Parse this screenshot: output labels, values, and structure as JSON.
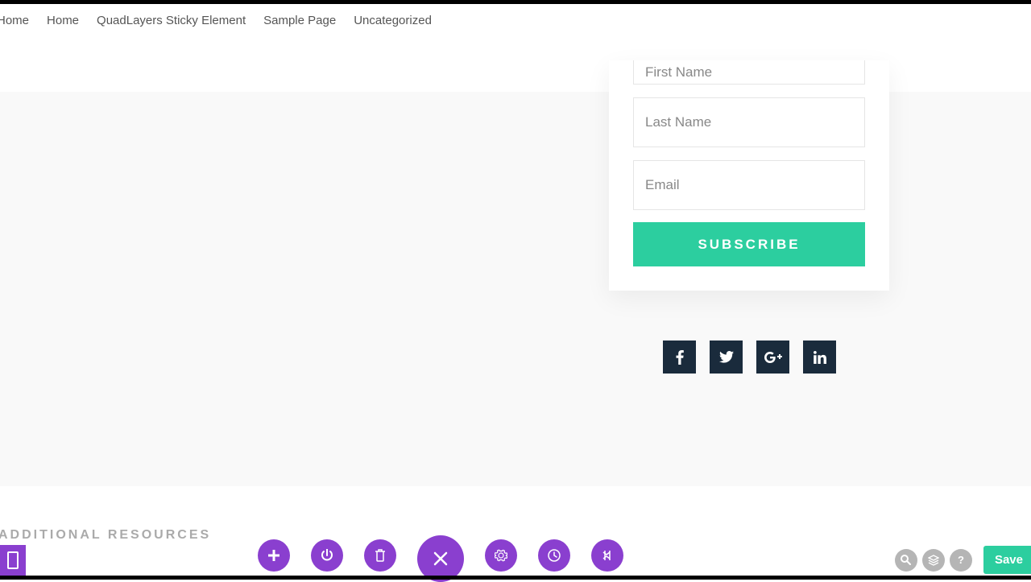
{
  "nav": {
    "items": [
      "Home",
      "Home",
      "QuadLayers Sticky Element",
      "Sample Page",
      "Uncategorized"
    ]
  },
  "form": {
    "first_name_placeholder": "First Name",
    "last_name_placeholder": "Last Name",
    "email_placeholder": "Email",
    "subscribe_label": "SUBSCRIBE"
  },
  "social": {
    "facebook": "facebook-icon",
    "twitter": "twitter-icon",
    "googleplus": "googleplus-icon",
    "linkedin": "linkedin-icon"
  },
  "section": {
    "additional_resources": "ADDITIONAL RESOURCES"
  },
  "toolbar": {
    "save_label": "Save"
  },
  "colors": {
    "accent": "#2cce9f",
    "builder": "#8a3fcf",
    "social_bg": "#1a2b3c"
  }
}
